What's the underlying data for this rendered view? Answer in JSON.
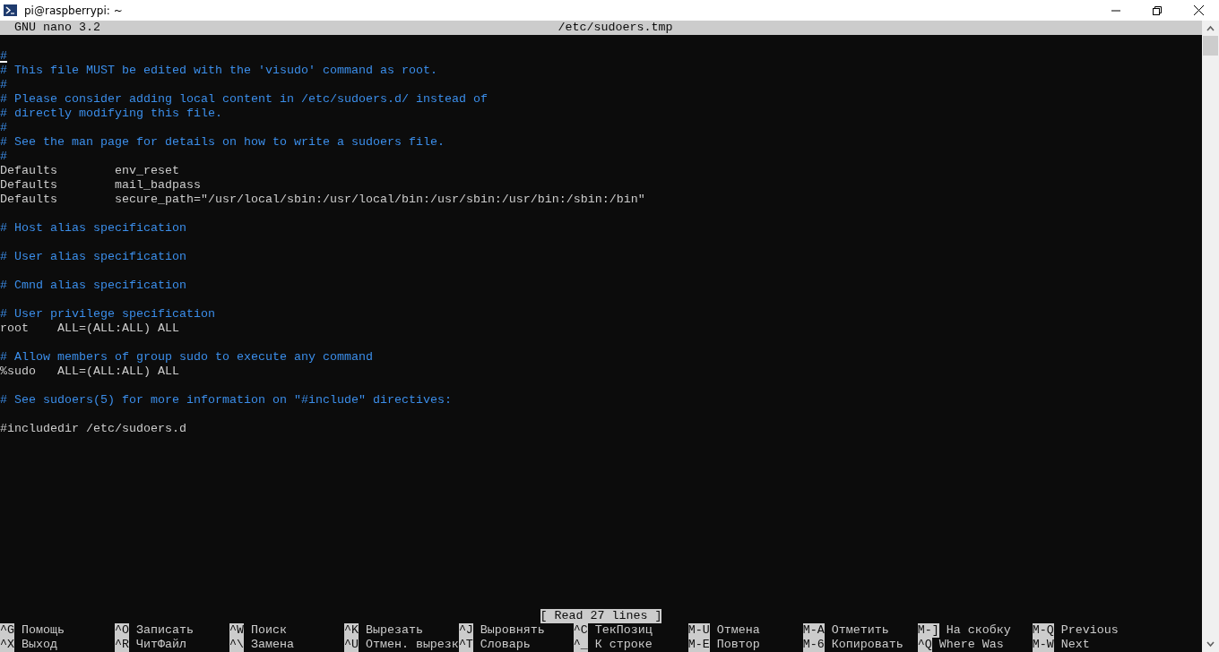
{
  "window": {
    "title": "pi@raspberrypi: ~"
  },
  "editor": {
    "app": "GNU nano 3.2",
    "filename": "/etc/sudoers.tmp",
    "lines": [
      {
        "kind": "blank",
        "cursor": false
      },
      {
        "kind": "comment",
        "text": "#",
        "cursor": true
      },
      {
        "kind": "comment",
        "text": "# This file MUST be edited with the 'visudo' command as root.",
        "cursor": false
      },
      {
        "kind": "comment",
        "text": "#",
        "cursor": false
      },
      {
        "kind": "comment",
        "text": "# Please consider adding local content in /etc/sudoers.d/ instead of",
        "cursor": false
      },
      {
        "kind": "comment",
        "text": "# directly modifying this file.",
        "cursor": false
      },
      {
        "kind": "comment",
        "text": "#",
        "cursor": false
      },
      {
        "kind": "comment",
        "text": "# See the man page for details on how to write a sudoers file.",
        "cursor": false
      },
      {
        "kind": "comment",
        "text": "#",
        "cursor": false
      },
      {
        "kind": "code",
        "text": "Defaults        env_reset",
        "cursor": false
      },
      {
        "kind": "code",
        "text": "Defaults        mail_badpass",
        "cursor": false
      },
      {
        "kind": "code",
        "text": "Defaults        secure_path=\"/usr/local/sbin:/usr/local/bin:/usr/sbin:/usr/bin:/sbin:/bin\"",
        "cursor": false
      },
      {
        "kind": "blank",
        "cursor": false
      },
      {
        "kind": "comment",
        "text": "# Host alias specification",
        "cursor": false
      },
      {
        "kind": "blank",
        "cursor": false
      },
      {
        "kind": "comment",
        "text": "# User alias specification",
        "cursor": false
      },
      {
        "kind": "blank",
        "cursor": false
      },
      {
        "kind": "comment",
        "text": "# Cmnd alias specification",
        "cursor": false
      },
      {
        "kind": "blank",
        "cursor": false
      },
      {
        "kind": "comment",
        "text": "# User privilege specification",
        "cursor": false
      },
      {
        "kind": "code",
        "text": "root    ALL=(ALL:ALL) ALL",
        "cursor": false
      },
      {
        "kind": "blank",
        "cursor": false
      },
      {
        "kind": "comment",
        "text": "# Allow members of group sudo to execute any command",
        "cursor": false
      },
      {
        "kind": "code",
        "text": "%sudo   ALL=(ALL:ALL) ALL",
        "cursor": false
      },
      {
        "kind": "blank",
        "cursor": false
      },
      {
        "kind": "comment",
        "text": "# See sudoers(5) for more information on \"#include\" directives:",
        "cursor": false
      },
      {
        "kind": "blank",
        "cursor": false
      },
      {
        "kind": "code",
        "text": "#includedir /etc/sudoers.d",
        "cursor": false
      }
    ],
    "status": "[ Read 27 lines ]",
    "shortcuts": [
      [
        {
          "key": "^G",
          "label": "Помощь"
        },
        {
          "key": "^O",
          "label": "Записать"
        },
        {
          "key": "^W",
          "label": "Поиск"
        },
        {
          "key": "^K",
          "label": "Вырезать"
        },
        {
          "key": "^J",
          "label": "Выровнять"
        },
        {
          "key": "^C",
          "label": "ТекПозиц"
        },
        {
          "key": "M-U",
          "label": "Отмена"
        },
        {
          "key": "M-A",
          "label": "Отметить"
        },
        {
          "key": "M-]",
          "label": "На скобку"
        },
        {
          "key": "M-Q",
          "label": "Previous"
        }
      ],
      [
        {
          "key": "^X",
          "label": "Выход"
        },
        {
          "key": "^R",
          "label": "ЧитФайл"
        },
        {
          "key": "^\\",
          "label": "Замена"
        },
        {
          "key": "^U",
          "label": "Отмен. вырезк"
        },
        {
          "key": "^T",
          "label": "Словарь"
        },
        {
          "key": "^_",
          "label": "К строке"
        },
        {
          "key": "M-E",
          "label": "Повтор"
        },
        {
          "key": "M-6",
          "label": "Копировать"
        },
        {
          "key": "^Q",
          "label": "Where Was"
        },
        {
          "key": "M-W",
          "label": "Next"
        }
      ]
    ]
  }
}
